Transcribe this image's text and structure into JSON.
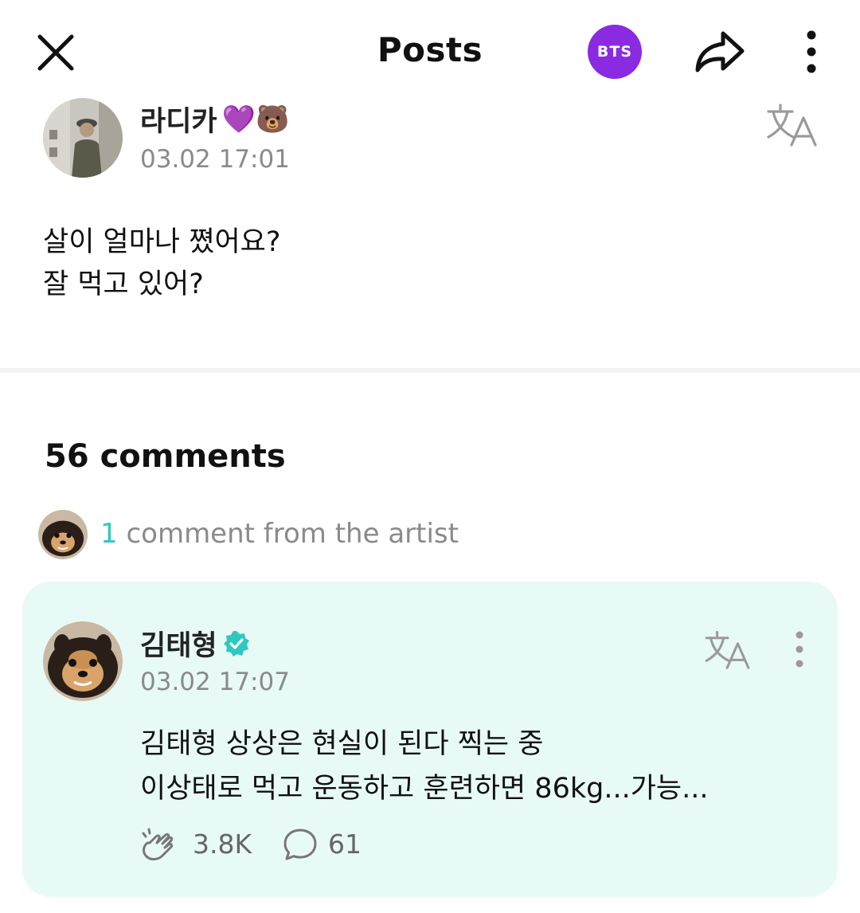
{
  "header": {
    "title": "Posts",
    "badge_label": "BTS",
    "badge_color": "#8a2be2"
  },
  "post": {
    "author": "라디카",
    "author_emoji": "💜🐻",
    "time": "03.02 17:01",
    "lines": [
      "살이 얼마나 쪘어요?",
      "잘 먹고 있어?"
    ]
  },
  "comments": {
    "count_label": "56 comments",
    "artist_count": "1",
    "artist_label": " comment from the artist"
  },
  "artist_comment": {
    "author": "김태형",
    "verified_icon": "verified-badge-icon",
    "time": "03.02 17:07",
    "lines": [
      "김태형 상상은 현실이 된다 찍는 중",
      "이상태로 먹고 운동하고 훈련하면 86kg...가능..."
    ],
    "likes": "3.8K",
    "replies": "61",
    "accent_color": "#2ec8c0",
    "card_color": "#e8faf6"
  }
}
